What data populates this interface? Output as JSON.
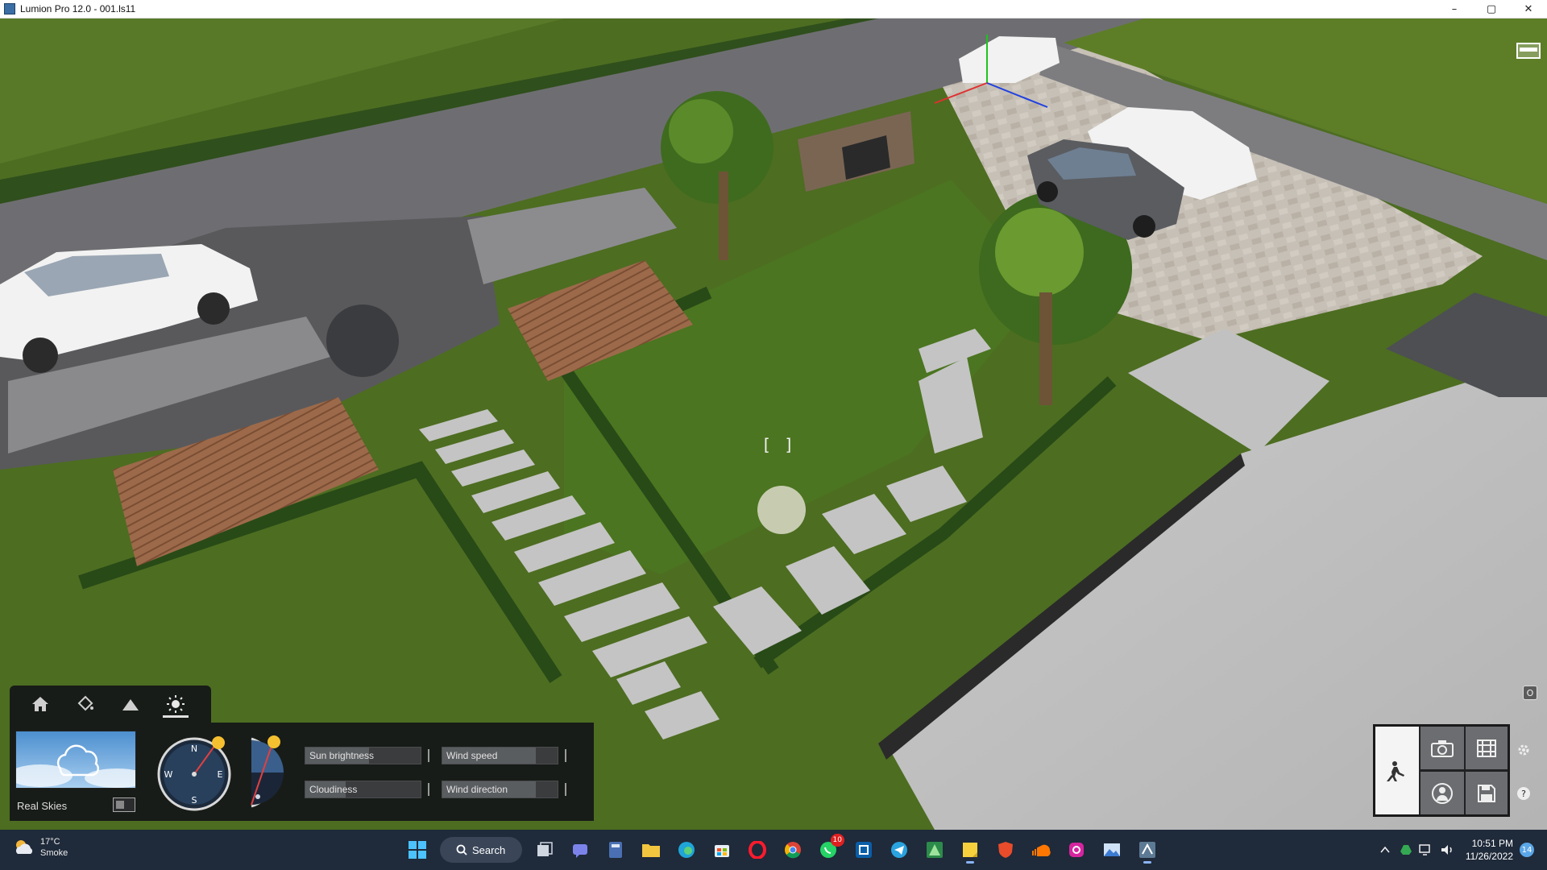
{
  "window": {
    "title": "Lumion Pro 12.0  - 001.ls11",
    "controls": {
      "minimize": "–",
      "maximize": "▢",
      "close": "✕"
    }
  },
  "viewport": {
    "reticle": "[ ]",
    "corner_badge": "O"
  },
  "weather_panel": {
    "tabs": [
      {
        "name": "home-icon",
        "active": false
      },
      {
        "name": "paint-bucket-icon",
        "active": false
      },
      {
        "name": "mountain-icon",
        "active": false
      },
      {
        "name": "sun-icon",
        "active": true
      }
    ],
    "real_skies_label": "Real Skies",
    "real_skies_enabled": false,
    "compass": {
      "n": "N",
      "e": "E",
      "s": "S",
      "w": "W"
    },
    "sliders": {
      "sun_brightness": {
        "label": "Sun brightness",
        "level": 0.55
      },
      "wind_speed": {
        "label": "Wind speed",
        "level": 0.81
      },
      "cloudiness": {
        "label": "Cloudiness",
        "level": 0.35
      },
      "wind_direction": {
        "label": "Wind direction",
        "level": 0.81
      }
    }
  },
  "mode_panel": {
    "buttons": [
      {
        "name": "build-mode-icon",
        "active": true
      },
      {
        "name": "photo-mode-icon",
        "active": false
      },
      {
        "name": "movie-mode-icon",
        "active": false
      },
      {
        "name": "panorama-mode-icon",
        "active": false
      },
      {
        "name": "save-icon",
        "active": false
      }
    ],
    "settings_icon": "settings-icon",
    "help_icon": "help-icon"
  },
  "taskbar": {
    "weather": {
      "temp": "17°C",
      "condition": "Smoke"
    },
    "search_label": "Search",
    "whatsapp_badge": "10",
    "clock": {
      "time": "10:51 PM",
      "date": "11/26/2022"
    },
    "notification_count": "14"
  },
  "colors": {
    "grass": "#4f6e22",
    "road": "#6e6e72",
    "paving": "#c8c3bc",
    "panel_bg": "#151618",
    "taskbar_bg": "#1f2a3a",
    "accent_blue": "#8ab4f8"
  }
}
